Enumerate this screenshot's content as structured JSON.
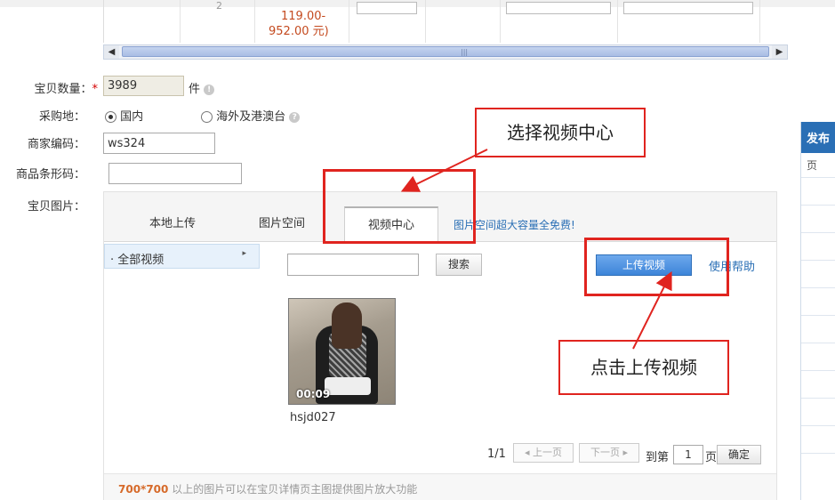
{
  "top_row": {
    "price_range_line1": "119.00-",
    "price_range_line2": "952.00 元)",
    "cut_text_left": "2"
  },
  "form": {
    "quantity_label": "宝贝数量：",
    "required_mark": "*",
    "quantity_value": "3989",
    "quantity_unit": "件",
    "purchase_label": "采购地：",
    "origin_domestic": "国内",
    "origin_overseas": "海外及港澳台",
    "merchant_code_label": "商家编码：",
    "merchant_code_value": "ws324",
    "barcode_label": "商品条形码：",
    "barcode_value": "",
    "images_label": "宝贝图片："
  },
  "tabs": [
    {
      "label": "本地上传",
      "active": false
    },
    {
      "label": "图片空间",
      "active": false
    },
    {
      "label": "视频中心",
      "active": true
    }
  ],
  "promo_text": "图片空间超大容量全免费!",
  "category": {
    "label": "全部视频"
  },
  "search": {
    "value": "",
    "button_label": "搜索"
  },
  "upload_button_label": "上传视频",
  "help_link_label": "使用帮助",
  "video": {
    "duration": "00:09",
    "name": "hsjd027"
  },
  "pager": {
    "page_status": "1/1",
    "prev_label": "上一页",
    "next_label": "下一页",
    "goto_prefix": "到第",
    "page_value": "1",
    "goto_suffix": "页",
    "confirm_label": "确定"
  },
  "bottom_note": {
    "size": "700*700",
    "text": "以上的图片可以在宝贝详情页主图提供图片放大功能"
  },
  "right_panel": {
    "header": "发布",
    "sub": "页"
  },
  "annotations": {
    "select_video_center": "选择视频中心",
    "click_upload_video": "点击上传视频"
  },
  "colors": {
    "annotation_red": "#e0241f",
    "link_blue": "#2a6fb5",
    "upload_button_blue": "#3d85d9",
    "price_orange": "#c44a1f"
  }
}
